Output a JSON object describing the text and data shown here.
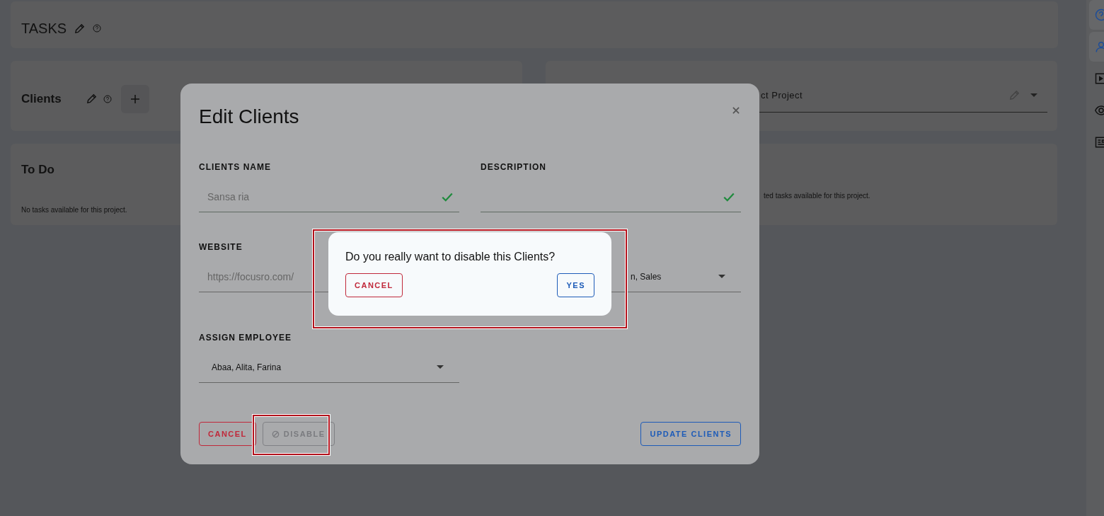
{
  "page": {
    "title": "TASKS"
  },
  "clients_panel": {
    "title": "Clients"
  },
  "project_select": {
    "value": "ct Project"
  },
  "todo": {
    "title": "To Do",
    "empty_text": "No tasks available for this project."
  },
  "completed": {
    "empty_text": "ted tasks available for this project."
  },
  "sidebar": {
    "items": [
      {
        "selected": true
      },
      {
        "selected": true
      },
      {
        "selected": false
      },
      {
        "selected": false
      },
      {
        "selected": false
      }
    ]
  },
  "modal": {
    "title": "Edit Clients",
    "fields": [
      {
        "kind": "text",
        "label": "CLIENTS NAME",
        "value": "Sansa ria",
        "valid": true
      },
      {
        "kind": "text",
        "label": "DESCRIPTION",
        "valid": true
      },
      {
        "kind": "text",
        "label": "WEBSITE",
        "value": "https://focusro.com/"
      },
      {
        "kind": "select",
        "value": "n, Sales"
      },
      {
        "kind": "select",
        "label": "ASSIGN EMPLOYEE",
        "value": "Abaa, Alita, Farina"
      }
    ],
    "buttons": {
      "cancel": "CANCEL",
      "disable": {
        "label": "DISABLE",
        "disabled": true
      },
      "update": "UPDATE CLIENTS"
    }
  },
  "confirm": {
    "message": "Do you really want to disable this Clients?",
    "cancel": "CANCEL",
    "confirm": "YES"
  }
}
